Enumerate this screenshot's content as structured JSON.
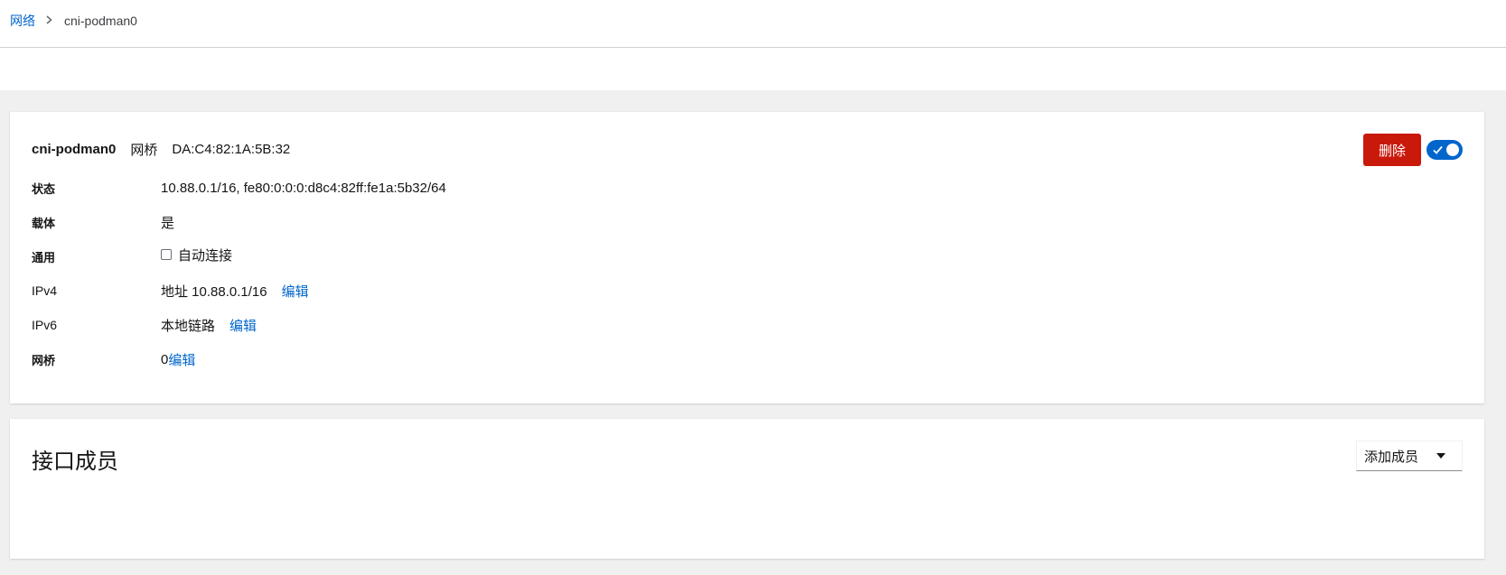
{
  "breadcrumb": {
    "parent": "网络",
    "current": "cni-podman0"
  },
  "interface": {
    "name": "cni-podman0",
    "type": "网桥",
    "mac": "DA:C4:82:1A:5B:32",
    "delete_label": "删除",
    "enabled": true
  },
  "details": {
    "status": {
      "label": "状态",
      "value": "10.88.0.1/16, fe80:0:0:0:d8c4:82ff:fe1a:5b32/64"
    },
    "carrier": {
      "label": "载体",
      "value": "是"
    },
    "general": {
      "label": "通用",
      "autoconnect_label": "自动连接",
      "autoconnect_checked": false
    },
    "ipv4": {
      "label": "IPv4",
      "value": "地址 10.88.0.1/16",
      "edit_label": "编辑"
    },
    "ipv6": {
      "label": "IPv6",
      "value": "本地链路",
      "edit_label": "编辑"
    },
    "bridge": {
      "label": "网桥",
      "value": "0",
      "edit_label": "编辑"
    }
  },
  "members": {
    "title": "接口成员",
    "add_label": "添加成员"
  },
  "colors": {
    "link": "#0066cc",
    "danger": "#c9190b",
    "toggle_on": "#0066cc",
    "page_bg": "#f0f0f0"
  },
  "icons": {
    "breadcrumb_separator": "chevron-right-icon",
    "toggle_check": "check-icon",
    "dropdown": "caret-down-icon"
  }
}
